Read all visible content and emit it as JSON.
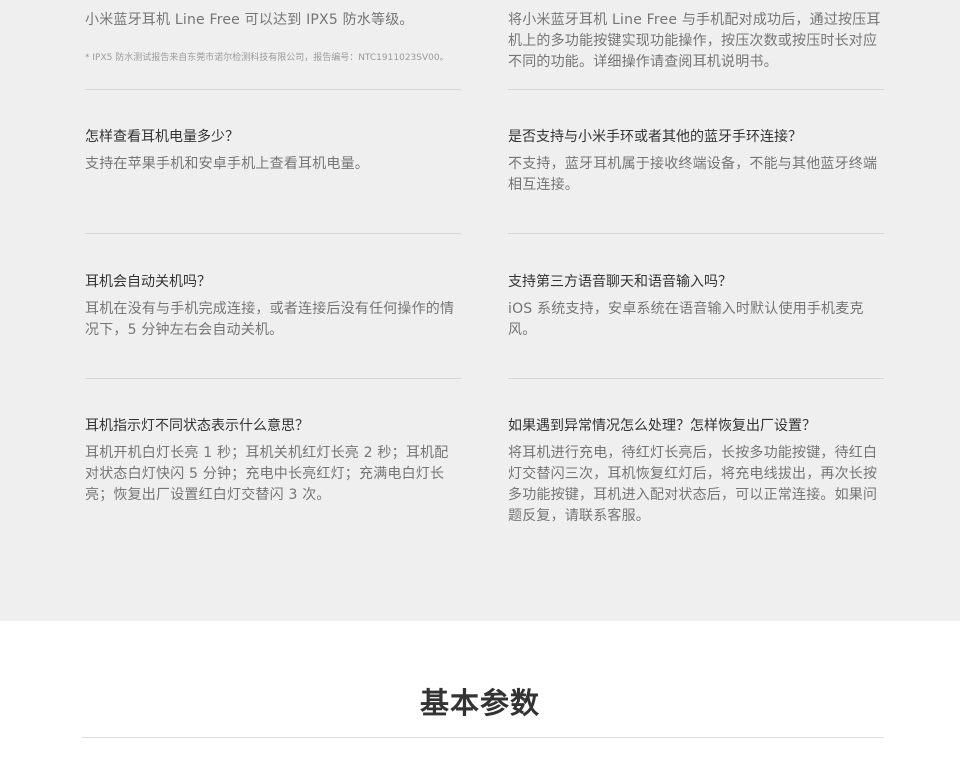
{
  "faq": {
    "left": [
      {
        "question": "",
        "answer": "小米蓝牙耳机 Line Free 可以达到 IPX5 防水等级。",
        "note": "* IPX5 防水测试报告来自东莞市诺尔检测科技有限公司，报告编号：NTC1911023SV00。"
      },
      {
        "question": "怎样查看耳机电量多少？",
        "answer": "支持在苹果手机和安卓手机上查看耳机电量。"
      },
      {
        "question": "耳机会自动关机吗？",
        "answer": "耳机在没有与手机完成连接，或者连接后没有任何操作的情况下，5 分钟左右会自动关机。"
      },
      {
        "question": "耳机指示灯不同状态表示什么意思？",
        "answer": "耳机开机白灯长亮 1 秒；耳机关机红灯长亮 2 秒；耳机配对状态白灯快闪 5 分钟；充电中长亮红灯；充满电白灯长亮；恢复出厂设置红白灯交替闪 3 次。"
      }
    ],
    "right": [
      {
        "question": "",
        "answer": "将小米蓝牙耳机 Line  Free 与手机配对成功后，通过按压耳机上的多功能按键实现功能操作，按压次数或按压时长对应不同的功能。详细操作请查阅耳机说明书。"
      },
      {
        "question": "是否支持与小米手环或者其他的蓝牙手环连接？",
        "answer": "不支持，蓝牙耳机属于接收终端设备，不能与其他蓝牙终端相互连接。"
      },
      {
        "question": "支持第三方语音聊天和语音输入吗？",
        "answer": "iOS 系统支持，安卓系统在语音输入时默认使用手机麦克风。"
      },
      {
        "question": "如果遇到异常情况怎么处理？怎样恢复出厂设置？",
        "answer": "将耳机进行充电，待红灯长亮后，长按多功能按键，待红白灯交替闪三次，耳机恢复红灯后，将充电线拔出，再次长按多功能按键，耳机进入配对状态后，可以正常连接。如果问题反复，请联系客服。"
      }
    ]
  },
  "params": {
    "title": "基本参数"
  }
}
